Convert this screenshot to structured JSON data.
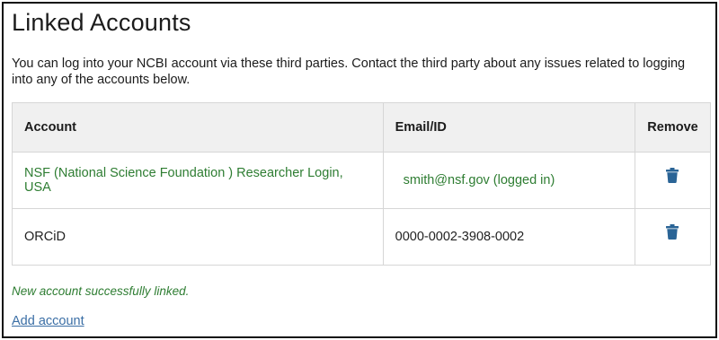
{
  "page": {
    "title": "Linked Accounts",
    "intro": "You can log into your NCBI account via these third parties. Contact the third party about any issues related to logging into any of the accounts below."
  },
  "table": {
    "headers": {
      "account": "Account",
      "email": "Email/ID",
      "remove": "Remove"
    },
    "rows": [
      {
        "account": "NSF (National Science Foundation ) Researcher Login, USA",
        "email": "smith@nsf.gov (logged in)",
        "remove_icon": "trash-icon"
      },
      {
        "account": "ORCiD",
        "email": "0000-0002-3908-0002",
        "remove_icon": "trash-icon"
      }
    ]
  },
  "status_message": "New account successfully linked.",
  "add_account_label": "Add account",
  "colors": {
    "accent_green": "#2e7d32",
    "link_blue": "#3a6ea5",
    "icon_blue": "#2a6496",
    "header_bg": "#f0f0f0"
  }
}
